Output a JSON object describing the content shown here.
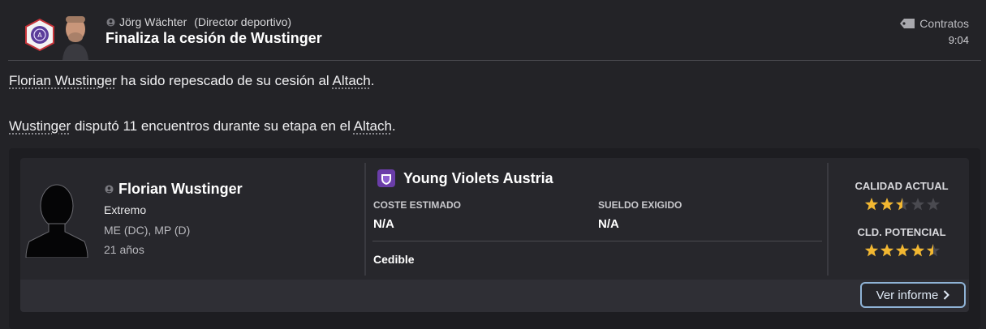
{
  "message": {
    "sender_name": "Jörg Wächter",
    "sender_role": "(Director deportivo)",
    "subject": "Finaliza la cesión de Wustinger",
    "category": "Contratos",
    "time": "9:04"
  },
  "body": {
    "line1": {
      "player": "Florian Wustinger",
      "mid": " ha sido repescado de su cesión al ",
      "club": "Altach",
      "end": "."
    },
    "line2": {
      "player": "Wustinger",
      "mid": " disputó 11 encuentros durante su etapa en el ",
      "club": "Altach",
      "end": "."
    }
  },
  "player_card": {
    "name": "Florian Wustinger",
    "role": "Extremo",
    "positions": "ME (DC), MP (D)",
    "age": "21 años",
    "team": "Young Violets Austria",
    "estimated_cost_label": "COSTE ESTIMADO",
    "estimated_cost": "N/A",
    "wage_label": "SUELDO EXIGIDO",
    "wage": "N/A",
    "status": "Cedible",
    "current_ability_label": "CALIDAD ACTUAL",
    "current_ability_stars": 2.5,
    "potential_ability_label": "CLD. POTENCIAL",
    "potential_ability_stars": 4.5,
    "max_stars": 5,
    "report_button": "Ver informe"
  },
  "colors": {
    "star_filled": "#f2b731",
    "star_empty": "#4a4a50",
    "club_purple": "#6a3da8",
    "button_border": "#8fb3d6"
  },
  "icons": [
    "person-icon",
    "tag-icon",
    "chevron-right-icon",
    "club-badge",
    "team-badge"
  ]
}
